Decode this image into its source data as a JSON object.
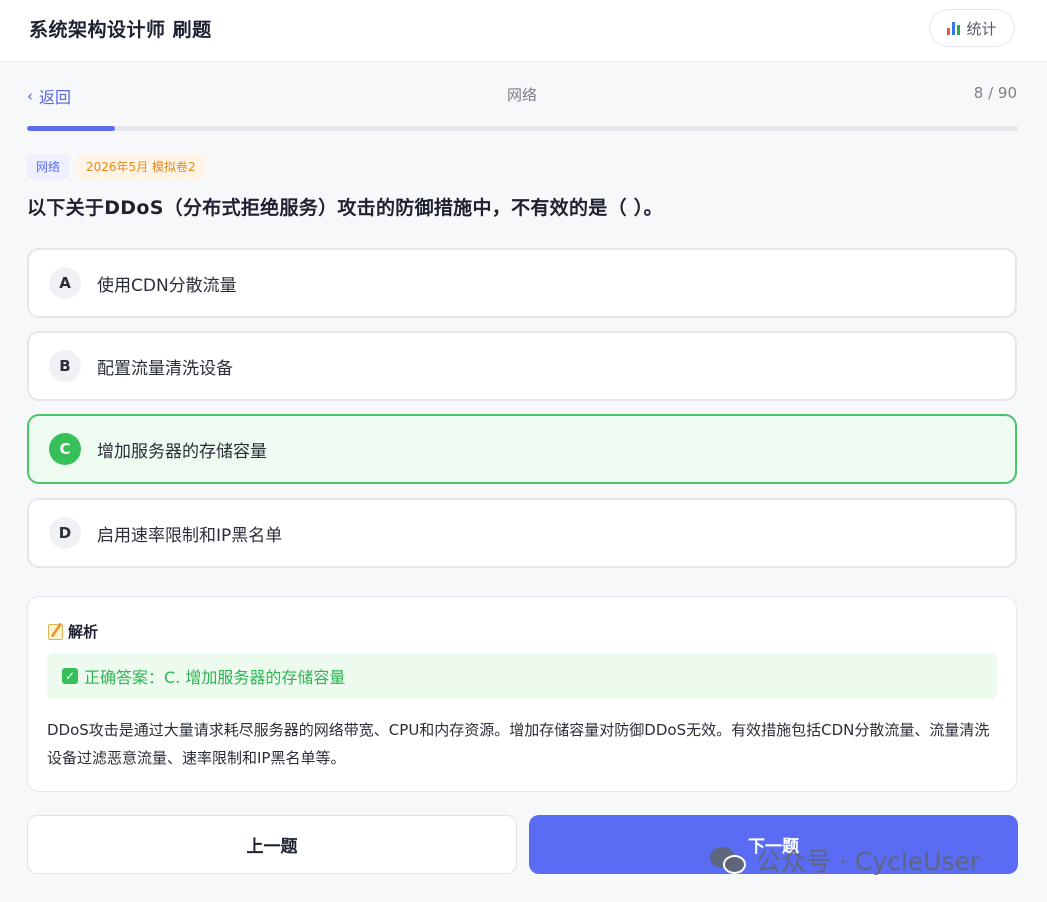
{
  "header": {
    "title": "系统架构设计师 刷题",
    "stats_label": "统计"
  },
  "nav": {
    "back_label": "返回",
    "back_chevron": "‹",
    "category": "网络",
    "progress_text": "8 / 90",
    "progress_fraction": 0.0889
  },
  "tags": {
    "category": "网络",
    "exam": "2026年5月 模拟卷2"
  },
  "question": {
    "text": "以下关于DDoS（分布式拒绝服务）攻击的防御措施中，不有效的是（ ）。"
  },
  "options": [
    {
      "letter": "A",
      "text": "使用CDN分散流量",
      "state": "default"
    },
    {
      "letter": "B",
      "text": "配置流量清洗设备",
      "state": "default"
    },
    {
      "letter": "C",
      "text": "增加服务器的存储容量",
      "state": "correct"
    },
    {
      "letter": "D",
      "text": "启用速率限制和IP黑名单",
      "state": "default"
    }
  ],
  "analysis": {
    "title": "解析",
    "answer_label": "正确答案：C. 增加服务器的存储容量",
    "explanation": "DDoS攻击是通过大量请求耗尽服务器的网络带宽、CPU和内存资源。增加存储容量对防御DDoS无效。有效措施包括CDN分散流量、流量清洗设备过滤恶意流量、速率限制和IP黑名单等。"
  },
  "buttons": {
    "prev_label": "上一题",
    "next_label": "下一题"
  },
  "watermark": {
    "text": "公众号 · CycleUser"
  },
  "colors": {
    "accent": "#5a6cf3",
    "correct": "#37c05a",
    "correct_bg": "#eefbf0",
    "tag_exam": "#e88a1a"
  },
  "icons": {
    "stats": "bar-chart-icon",
    "analysis": "memo-icon",
    "answer": "check-mark-icon",
    "watermark": "wechat-icon"
  }
}
